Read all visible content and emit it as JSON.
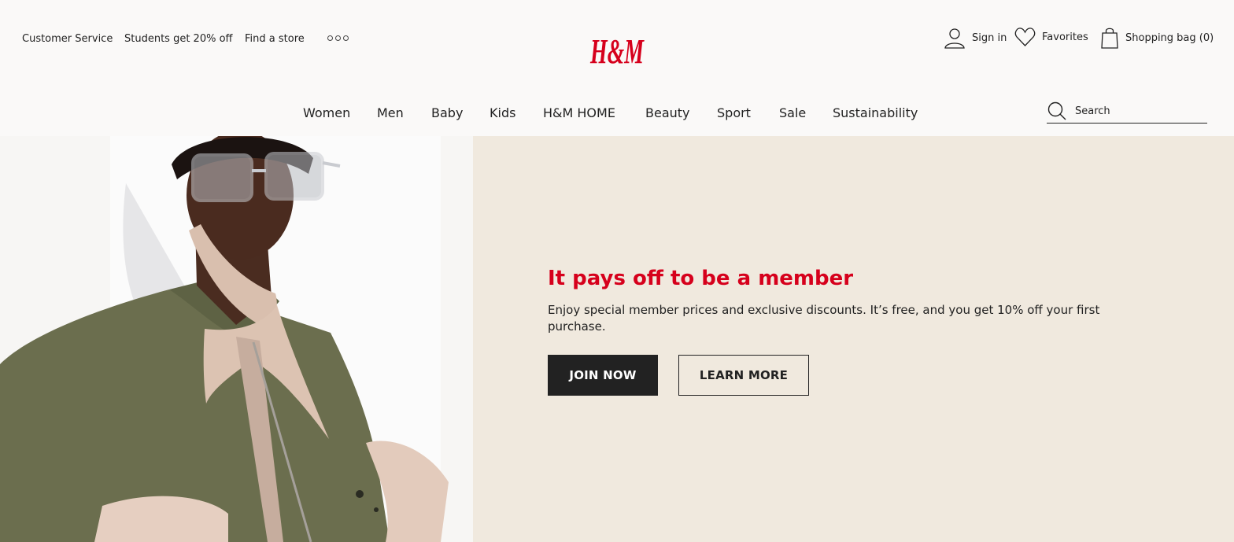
{
  "utility_nav": {
    "customer_service": "Customer Service",
    "students": "Students get 20% off",
    "find_store": "Find a store",
    "more_icon": "more-dots-icon"
  },
  "brand": {
    "logo_text": "H&M",
    "color": "#d6001c"
  },
  "account": {
    "sign_in": "Sign in",
    "favorites": "Favorites",
    "bag": "Shopping bag (0)"
  },
  "main_nav": {
    "items": [
      "Women",
      "Men",
      "Baby",
      "Kids",
      "H&M HOME",
      "Beauty",
      "Sport",
      "Sale",
      "Sustainability"
    ]
  },
  "search": {
    "placeholder": "Search"
  },
  "promo": {
    "title": "It pays off to be a member",
    "text": "Enjoy special member prices and exclusive discounts. It’s free, and you get 10% off your first purchase.",
    "join_label": "JOIN NOW",
    "learn_label": "LEARN MORE",
    "title_color": "#d6001c",
    "panel_color": "#f0e9de"
  }
}
